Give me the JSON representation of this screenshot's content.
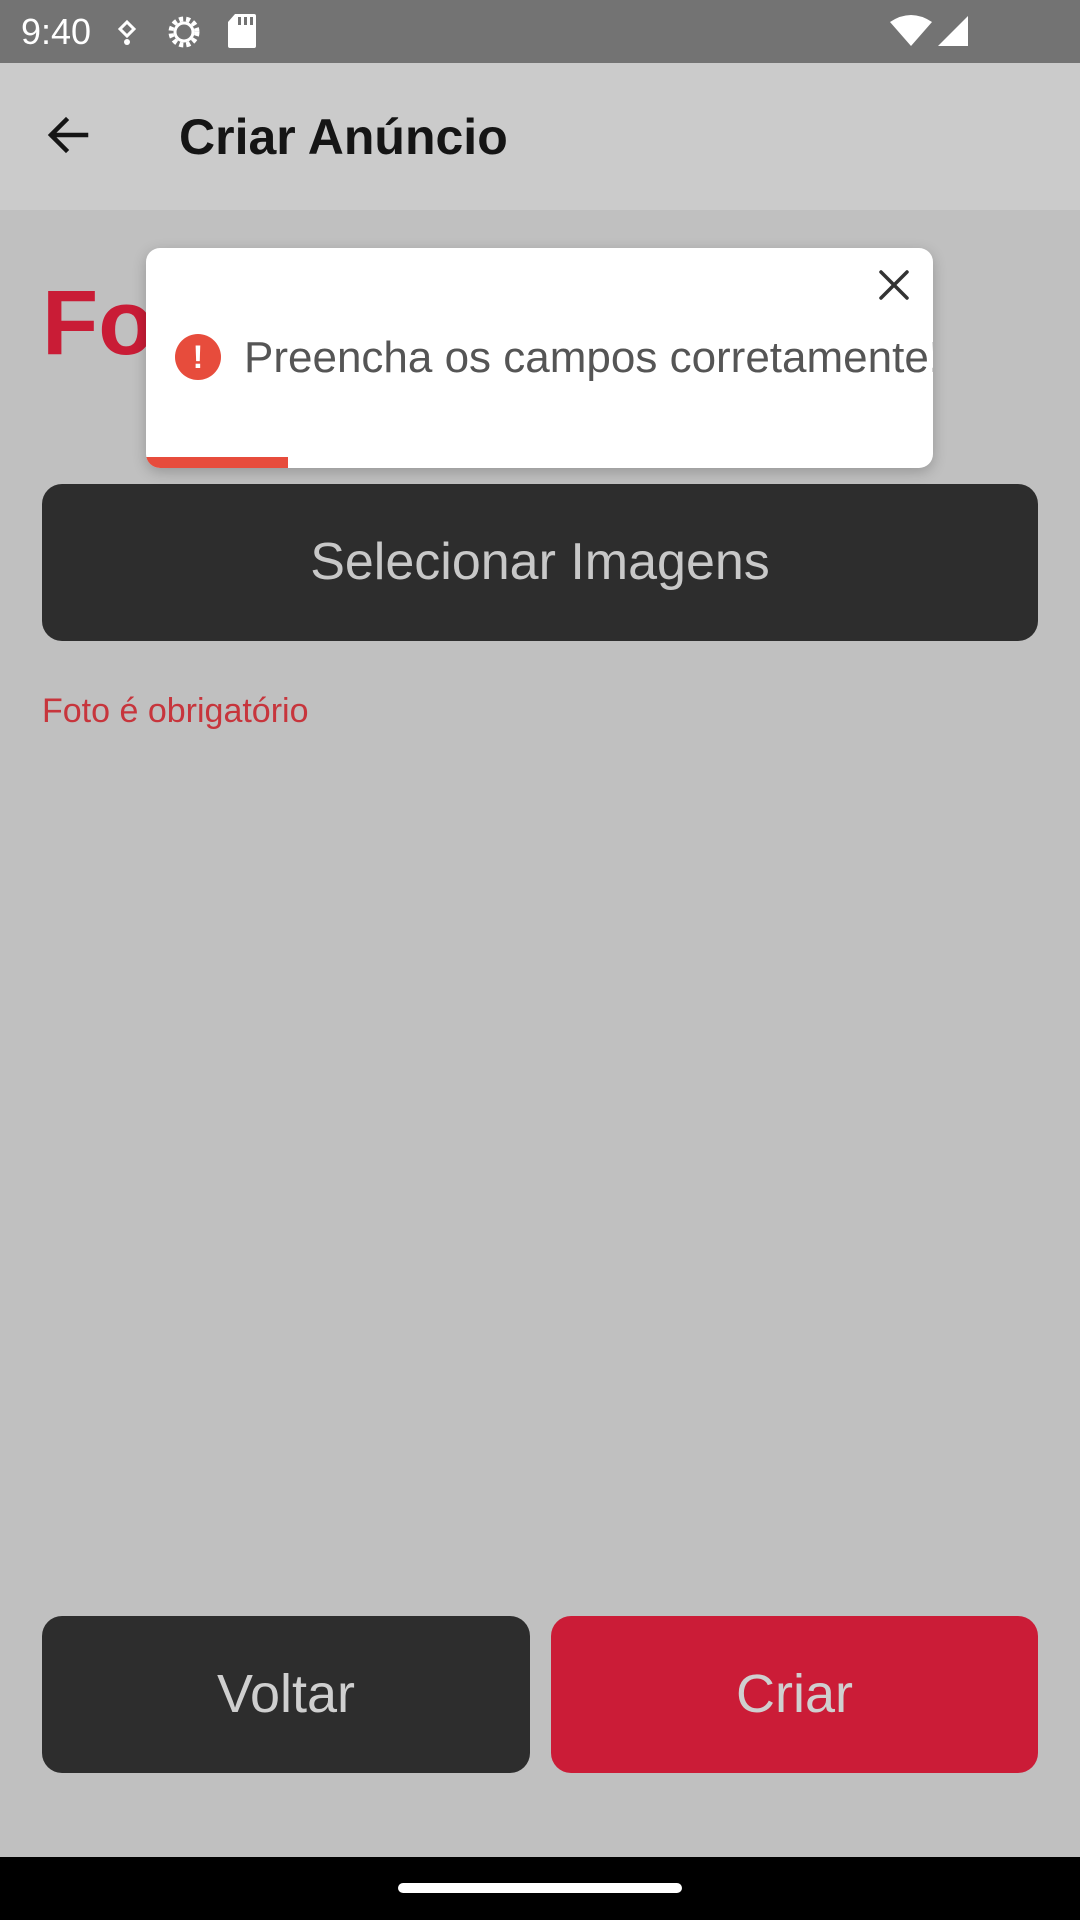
{
  "status_bar": {
    "time": "9:40",
    "icons": [
      "usb-debug-icon",
      "settings-gear-icon",
      "sd-card-icon",
      "wifi-icon",
      "cell-signal-icon"
    ]
  },
  "app_bar": {
    "title": "Criar Anúncio",
    "back_icon": "arrow-back-icon"
  },
  "main": {
    "section_heading": "Fo",
    "select_images_label": "Selecionar Imagens",
    "photo_error": "Foto é obrigatório"
  },
  "toast": {
    "message": "Preencha os campos corretamente!",
    "icon": "error-icon",
    "icon_glyph": "!",
    "close_icon": "close-icon",
    "progress": 0.18
  },
  "footer": {
    "back_label": "Voltar",
    "create_label": "Criar"
  },
  "colors": {
    "accent_red": "#cb1c37",
    "error_red": "#e74c3c",
    "dark_button": "#2d2d2d",
    "background": "#c0c0c0"
  }
}
